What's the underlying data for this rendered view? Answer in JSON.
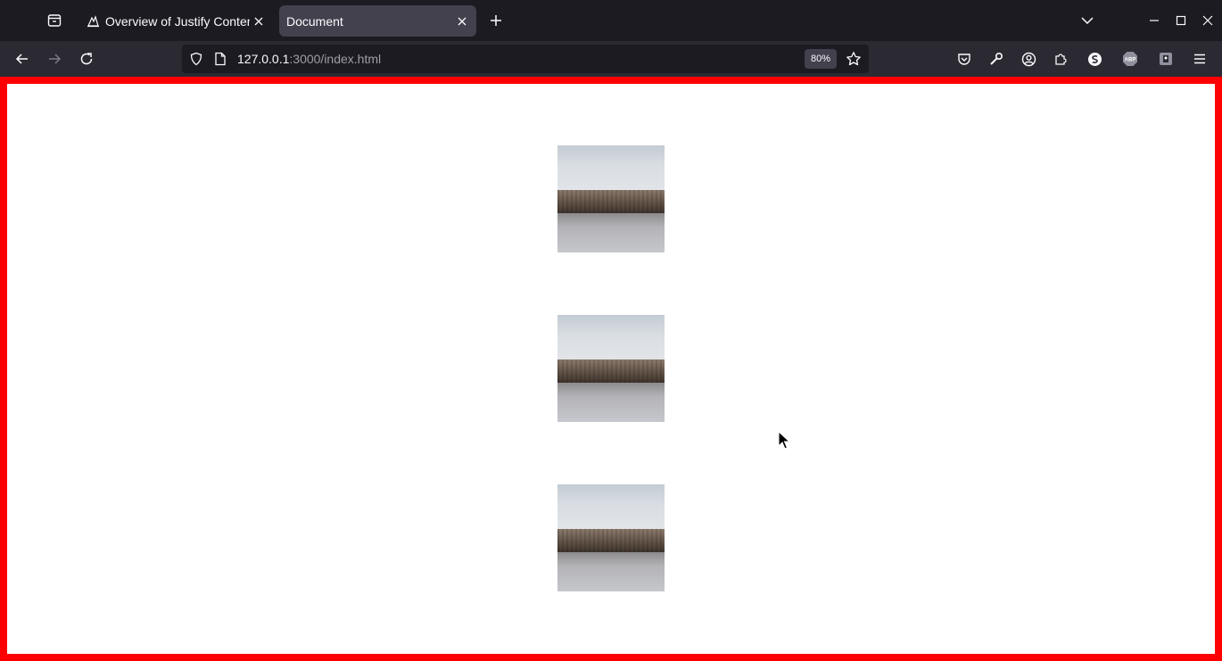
{
  "browser": {
    "tabs": [
      {
        "title": "Overview of Justify Content",
        "active": false
      },
      {
        "title": "Document",
        "active": true
      }
    ],
    "url_host": "127.0.0.1",
    "url_rest": ":3000/index.html",
    "zoom": "80%"
  },
  "page": {
    "border_color": "#ff0000",
    "images": [
      {
        "subject": "sky-rocks-water-photo"
      },
      {
        "subject": "sky-rocks-water-photo"
      },
      {
        "subject": "sky-rocks-water-photo"
      }
    ]
  },
  "colors": {
    "tabbar_bg": "#1c1b22",
    "navbar_bg": "#2b2a33",
    "active_tab_bg": "#42414d",
    "text": "#fbfbfe"
  }
}
